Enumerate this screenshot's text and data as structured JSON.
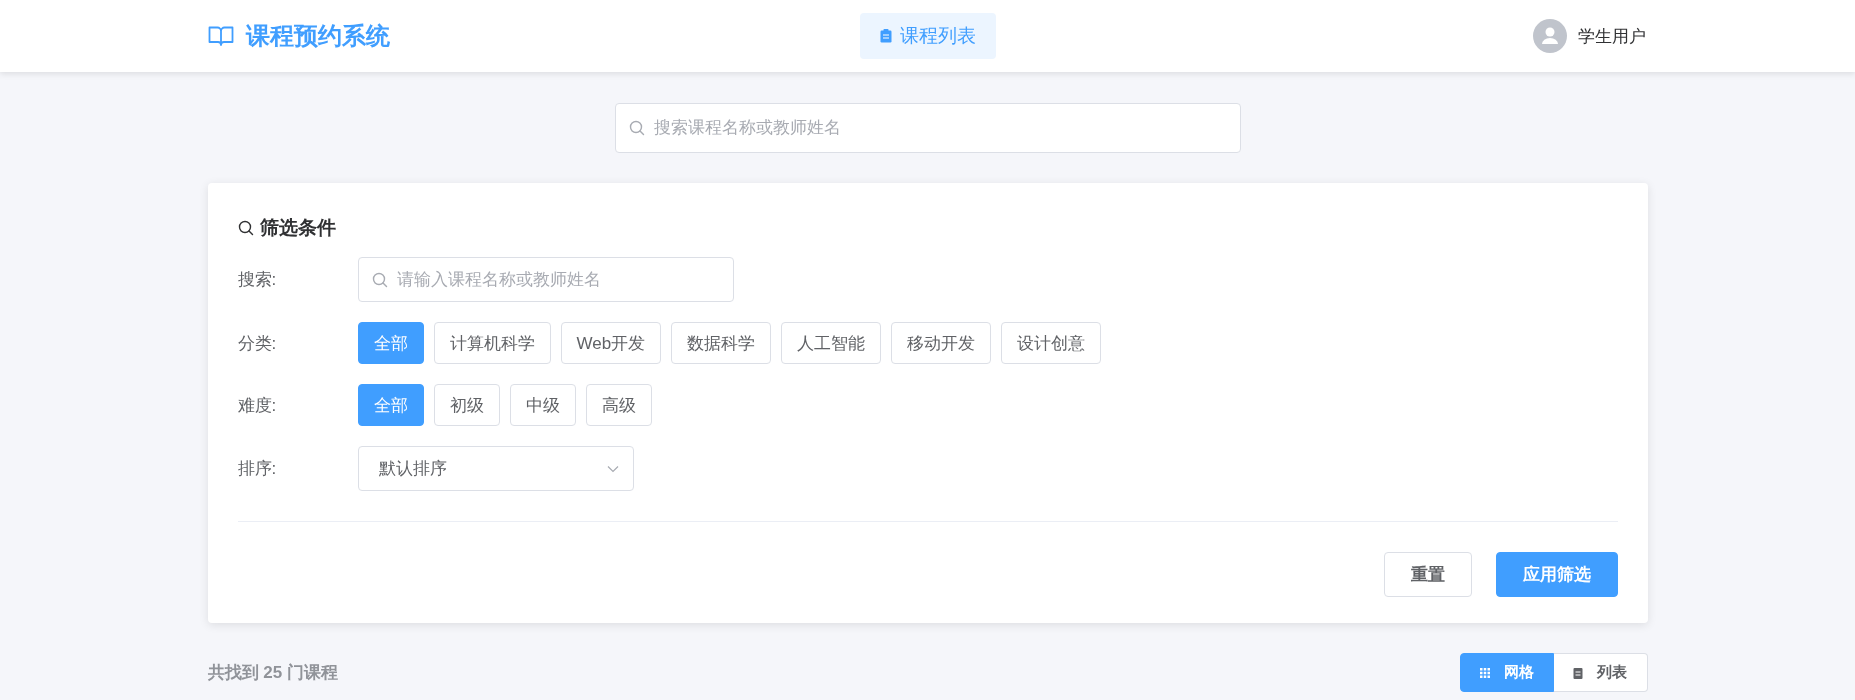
{
  "header": {
    "logo": "课程预约系统",
    "nav": [
      {
        "label": "课程列表",
        "selected": true
      }
    ],
    "user": "学生用户"
  },
  "top_search": {
    "placeholder": "搜索课程名称或教师姓名"
  },
  "filter": {
    "title": "筛选条件",
    "search": {
      "label": "搜索:",
      "placeholder": "请输入课程名称或教师姓名"
    },
    "category": {
      "label": "分类:",
      "options": [
        {
          "label": "全部",
          "selected": true
        },
        {
          "label": "计算机科学",
          "selected": false
        },
        {
          "label": "Web开发",
          "selected": false
        },
        {
          "label": "数据科学",
          "selected": false
        },
        {
          "label": "人工智能",
          "selected": false
        },
        {
          "label": "移动开发",
          "selected": false
        },
        {
          "label": "设计创意",
          "selected": false
        }
      ]
    },
    "difficulty": {
      "label": "难度:",
      "options": [
        {
          "label": "全部",
          "selected": true
        },
        {
          "label": "初级",
          "selected": false
        },
        {
          "label": "中级",
          "selected": false
        },
        {
          "label": "高级",
          "selected": false
        }
      ]
    },
    "sort": {
      "label": "排序:",
      "value": "默认排序"
    },
    "buttons": [
      {
        "label": "重置",
        "kind": "secondary"
      },
      {
        "label": "应用筛选",
        "kind": "primary"
      }
    ]
  },
  "results": {
    "count": "共找到 25 门课程",
    "views": [
      {
        "label": "网格",
        "kind": "grid",
        "selected": true
      },
      {
        "label": "列表",
        "kind": "list",
        "selected": false
      }
    ]
  }
}
